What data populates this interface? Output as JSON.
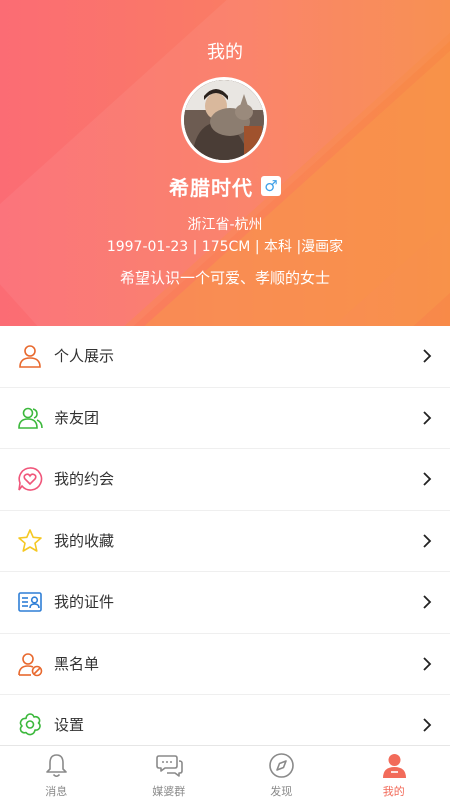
{
  "header": {
    "title": "我的",
    "nickname": "希腊时代",
    "gender_symbol": "♂",
    "location": "浙江省-杭州",
    "info": "1997-01-23 | 175CM | 本科 |漫画家",
    "slogan": "希望认识一个可爱、孝顺的女士"
  },
  "colors": {
    "gradient_start": "#fb6c74",
    "gradient_end": "#f88a48",
    "accent": "#f26b5a",
    "gender_badge_text": "#3fa0e8"
  },
  "menu": [
    {
      "label": "个人展示",
      "icon": "person-icon",
      "icon_color": "#e8692e"
    },
    {
      "label": "亲友团",
      "icon": "group-icon",
      "icon_color": "#3cb83c"
    },
    {
      "label": "我的约会",
      "icon": "heart-chat-icon",
      "icon_color": "#f0567a"
    },
    {
      "label": "我的收藏",
      "icon": "star-icon",
      "icon_color": "#f5c823"
    },
    {
      "label": "我的证件",
      "icon": "id-card-icon",
      "icon_color": "#2f7fd6"
    },
    {
      "label": "黑名单",
      "icon": "block-user-icon",
      "icon_color": "#e8692e"
    },
    {
      "label": "设置",
      "icon": "settings-icon",
      "icon_color": "#3cb83c"
    }
  ],
  "tabs": [
    {
      "label": "消息",
      "icon": "bell-icon",
      "active": false
    },
    {
      "label": "媒婆群",
      "icon": "chat-bubbles-icon",
      "active": false
    },
    {
      "label": "发现",
      "icon": "compass-icon",
      "active": false
    },
    {
      "label": "我的",
      "icon": "profile-icon",
      "active": true
    }
  ]
}
